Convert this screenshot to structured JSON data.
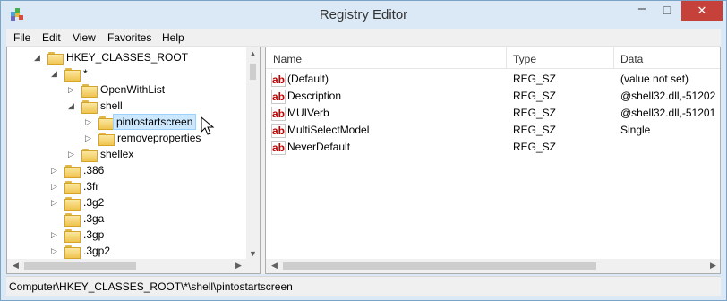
{
  "window": {
    "title": "Registry Editor",
    "accent": "#c7413b",
    "titlebar_color": "#dbe9f6"
  },
  "menu": {
    "items": [
      "File",
      "Edit",
      "View",
      "Favorites",
      "Help"
    ]
  },
  "tree": {
    "root": "HKEY_CLASSES_ROOT",
    "star": "*",
    "openwithlist": "OpenWithList",
    "shell": "shell",
    "selected": "pintostartscreen",
    "removeproperties": "removeproperties",
    "shellex": "shellex",
    "ext_386": ".386",
    "ext_3fr": ".3fr",
    "ext_3g2": ".3g2",
    "ext_3ga": ".3ga",
    "ext_3gp": ".3gp",
    "ext_3gp2": ".3gp2"
  },
  "list": {
    "headers": {
      "name": "Name",
      "type": "Type",
      "data": "Data"
    },
    "rows": [
      {
        "name": "(Default)",
        "type": "REG_SZ",
        "data": "(value not set)"
      },
      {
        "name": "Description",
        "type": "REG_SZ",
        "data": "@shell32.dll,-51202"
      },
      {
        "name": "MUIVerb",
        "type": "REG_SZ",
        "data": "@shell32.dll,-51201"
      },
      {
        "name": "MultiSelectModel",
        "type": "REG_SZ",
        "data": "Single"
      },
      {
        "name": "NeverDefault",
        "type": "REG_SZ",
        "data": ""
      }
    ]
  },
  "status": {
    "path": "Computer\\HKEY_CLASSES_ROOT\\*\\shell\\pintostartscreen"
  },
  "icons": {
    "value_icon": "ab",
    "minimize": "–",
    "maximize": "□",
    "close": "✕"
  }
}
